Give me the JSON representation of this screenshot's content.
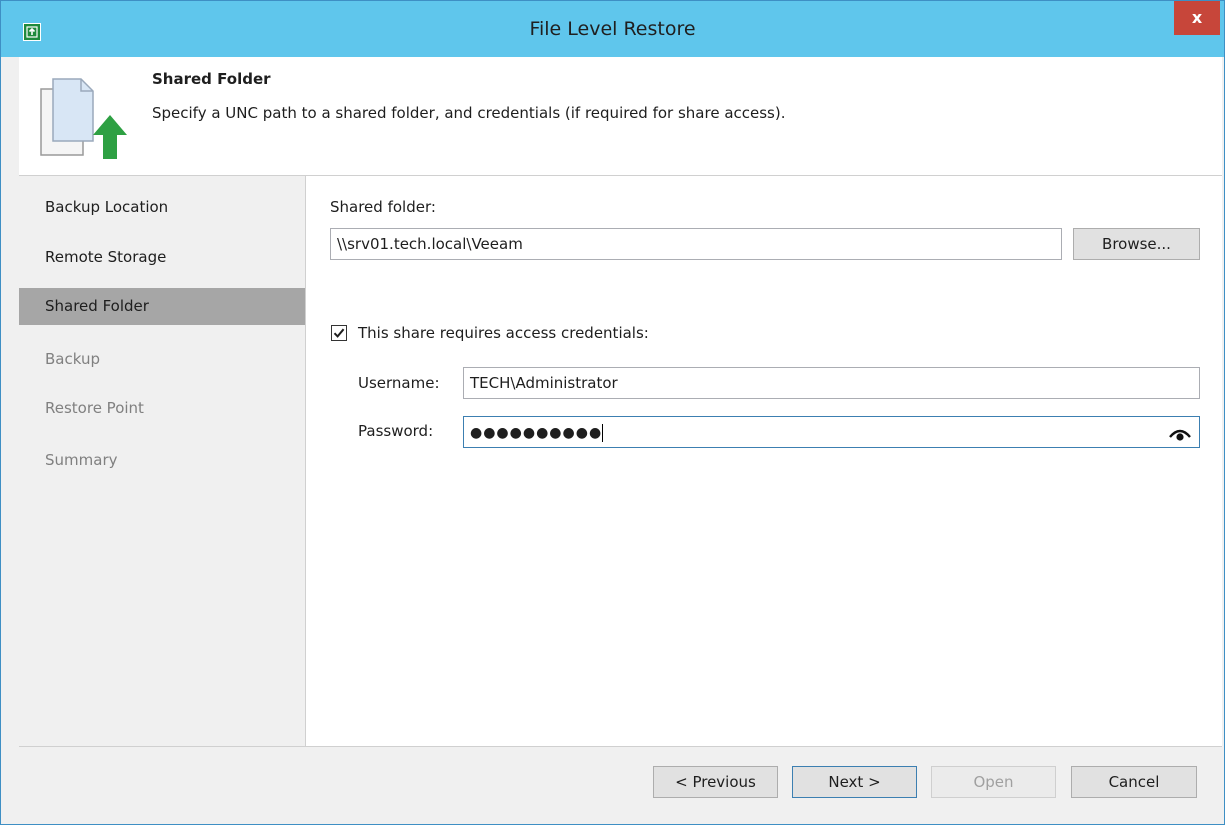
{
  "window": {
    "title": "File Level Restore",
    "close_label": "x",
    "app_icon": "restore-icon"
  },
  "header": {
    "title": "Shared Folder",
    "description": "Specify a UNC path to a shared folder, and credentials (if required for share access).",
    "icon": "file-upload-icon"
  },
  "sidebar": {
    "items": [
      {
        "label": "Backup Location",
        "state": "done"
      },
      {
        "label": "Remote Storage",
        "state": "done"
      },
      {
        "label": "Shared Folder",
        "state": "active"
      },
      {
        "label": "Backup",
        "state": "pending"
      },
      {
        "label": "Restore Point",
        "state": "pending"
      },
      {
        "label": "Summary",
        "state": "pending"
      }
    ]
  },
  "form": {
    "shared_folder_label": "Shared folder:",
    "shared_folder_value": "\\\\srv01.tech.local\\Veeam",
    "browse_label": "Browse...",
    "credentials_checkbox_label": "This share requires access credentials:",
    "credentials_checked": true,
    "username_label": "Username:",
    "username_value": "TECH\\Administrator",
    "password_label": "Password:",
    "password_value": "●●●●●●●●●●",
    "show_password_icon": "eye-icon"
  },
  "footer": {
    "previous_label": "< Previous",
    "next_label": "Next >",
    "open_label": "Open",
    "cancel_label": "Cancel"
  },
  "colors": {
    "titlebar": "#5fc6ec",
    "close_button": "#c7463a",
    "active_nav": "#a6a6a6",
    "accent_green": "#2ea043"
  }
}
